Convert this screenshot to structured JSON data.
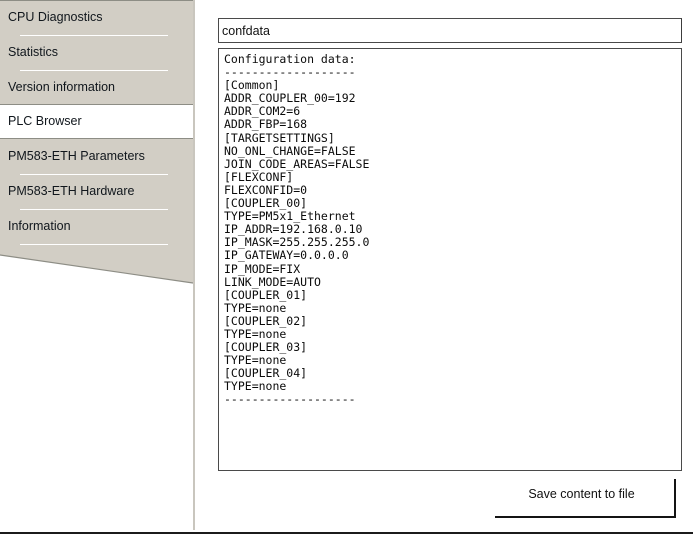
{
  "sidebar": {
    "items_top": [
      {
        "label": "CPU Diagnostics"
      },
      {
        "label": "Statistics"
      },
      {
        "label": "Version  information"
      }
    ],
    "selected_item": {
      "label": "PLC Browser"
    },
    "items_bottom": [
      {
        "label": "PM583-ETH Parameters"
      },
      {
        "label": "PM583-ETH Hardware"
      },
      {
        "label": "Information"
      }
    ]
  },
  "main": {
    "command_input": {
      "value": "confdata",
      "placeholder": ""
    },
    "output": "Configuration data:\n-------------------\n[Common]\nADDR_COUPLER_00=192\nADDR_COM2=6\nADDR_FBP=168\n[TARGETSETTINGS]\nNO_ONL_CHANGE=FALSE\nJOIN_CODE_AREAS=FALSE\n[FLEXCONF]\nFLEXCONFID=0\n[COUPLER_00]\nTYPE=PM5x1_Ethernet\nIP_ADDR=192.168.0.10\nIP_MASK=255.255.255.0\nIP_GATEWAY=0.0.0.0\nIP_MODE=FIX\nLINK_MODE=AUTO\n[COUPLER_01]\nTYPE=none\n[COUPLER_02]\nTYPE=none\n[COUPLER_03]\nTYPE=none\n[COUPLER_04]\nTYPE=none\n-------------------",
    "save_button_label": "Save content to file"
  },
  "colors": {
    "panel_background": "#d2cec5",
    "panel_border": "#8d8d85",
    "selected_background": "#ffffff",
    "text": "#10161c",
    "field_border": "#4a4a4a",
    "button_edge": "#141414"
  }
}
